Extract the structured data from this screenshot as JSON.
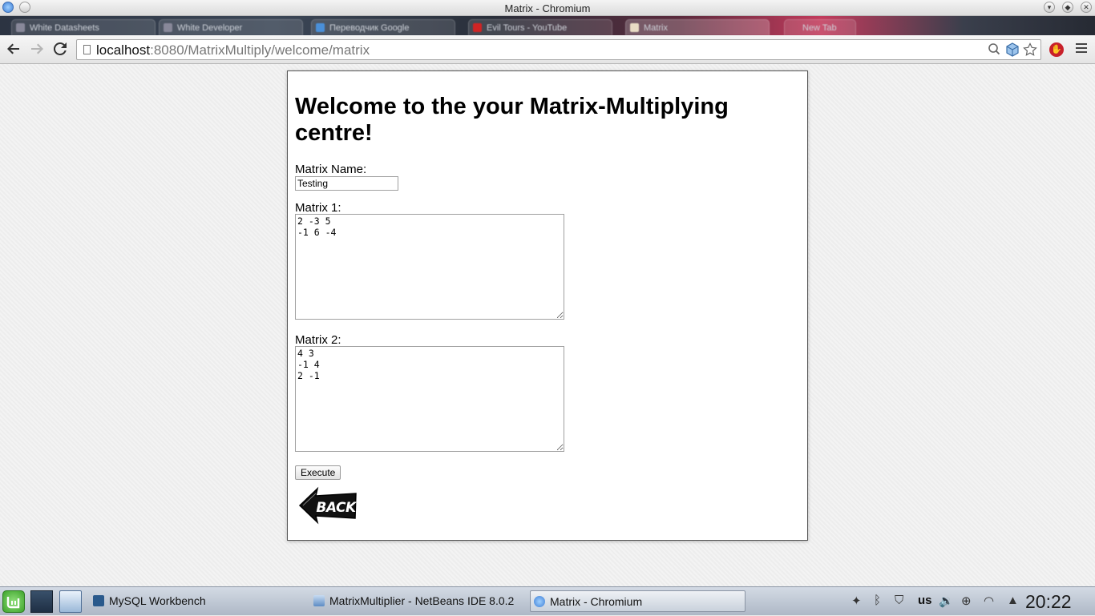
{
  "window": {
    "title": "Matrix - Chromium"
  },
  "tabs": [
    {
      "label": "White Datasheets"
    },
    {
      "label": "White Developer"
    },
    {
      "label": "Переводчик Google"
    },
    {
      "label": "Evil Tours - YouTube"
    },
    {
      "label": "Matrix"
    },
    {
      "label": "New Tab"
    }
  ],
  "toolbar": {
    "url_host": "localhost",
    "url_path": ":8080/MatrixMultiply/welcome/matrix",
    "back_icon": "arrow-left-icon",
    "forward_icon": "arrow-right-icon",
    "reload_icon": "reload-icon"
  },
  "page": {
    "heading": "Welcome to the your Matrix-Multiplying centre!",
    "name_label": "Matrix Name:",
    "name_value": "Testing",
    "matrix1_label": "Matrix 1:",
    "matrix1_value": "2 -3 5\n-1 6 -4",
    "matrix2_label": "Matrix 2:",
    "matrix2_value": "4 3\n-1 4\n2 -1",
    "execute_label": "Execute",
    "back_image_text": "BACK"
  },
  "taskbar": {
    "tasks": [
      {
        "label": "MySQL Workbench"
      },
      {
        "label": "MatrixMultiplier - NetBeans IDE 8.0.2"
      },
      {
        "label": "Matrix - Chromium"
      }
    ],
    "keyboard_layout": "us",
    "clock": "20:22"
  },
  "colors": {
    "card_border": "#555555",
    "page_background": "#ededed",
    "stop_extension": "#c8202a"
  }
}
